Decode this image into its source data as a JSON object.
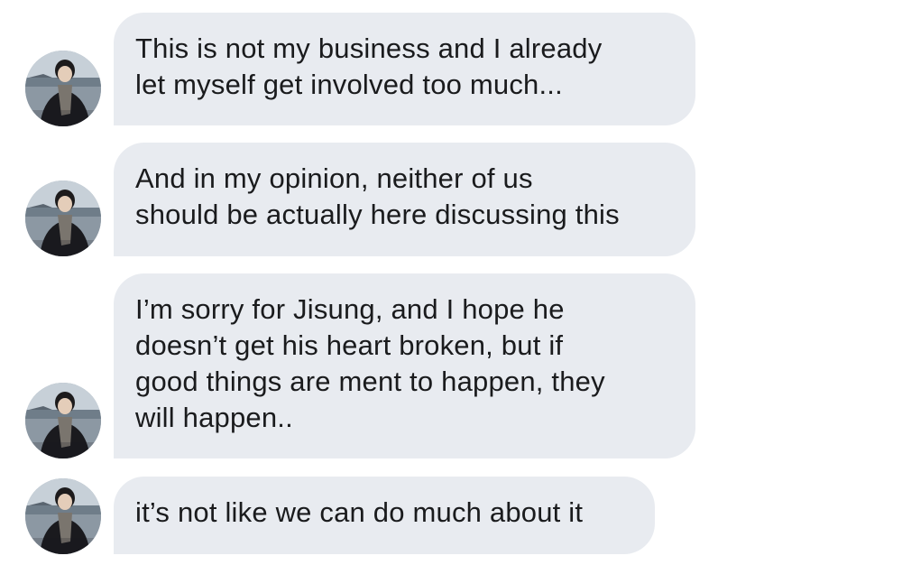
{
  "thread": {
    "messages": [
      {
        "text": "This is not my business and I already\nlet myself get involved too much..."
      },
      {
        "text": "And in my opinion, neither of us\nshould be actually here discussing this"
      },
      {
        "text": "I’m sorry for Jisung, and I hope he\ndoesn’t get his heart broken, but if\ngood things are ment to happen, they\nwill happen.."
      },
      {
        "text": "it’s not like we can do much about it"
      }
    ]
  },
  "colors": {
    "bubble_bg": "#e8ebf0",
    "text": "#1a1b1d"
  },
  "icons": {
    "avatar": "profile-photo-icon"
  }
}
